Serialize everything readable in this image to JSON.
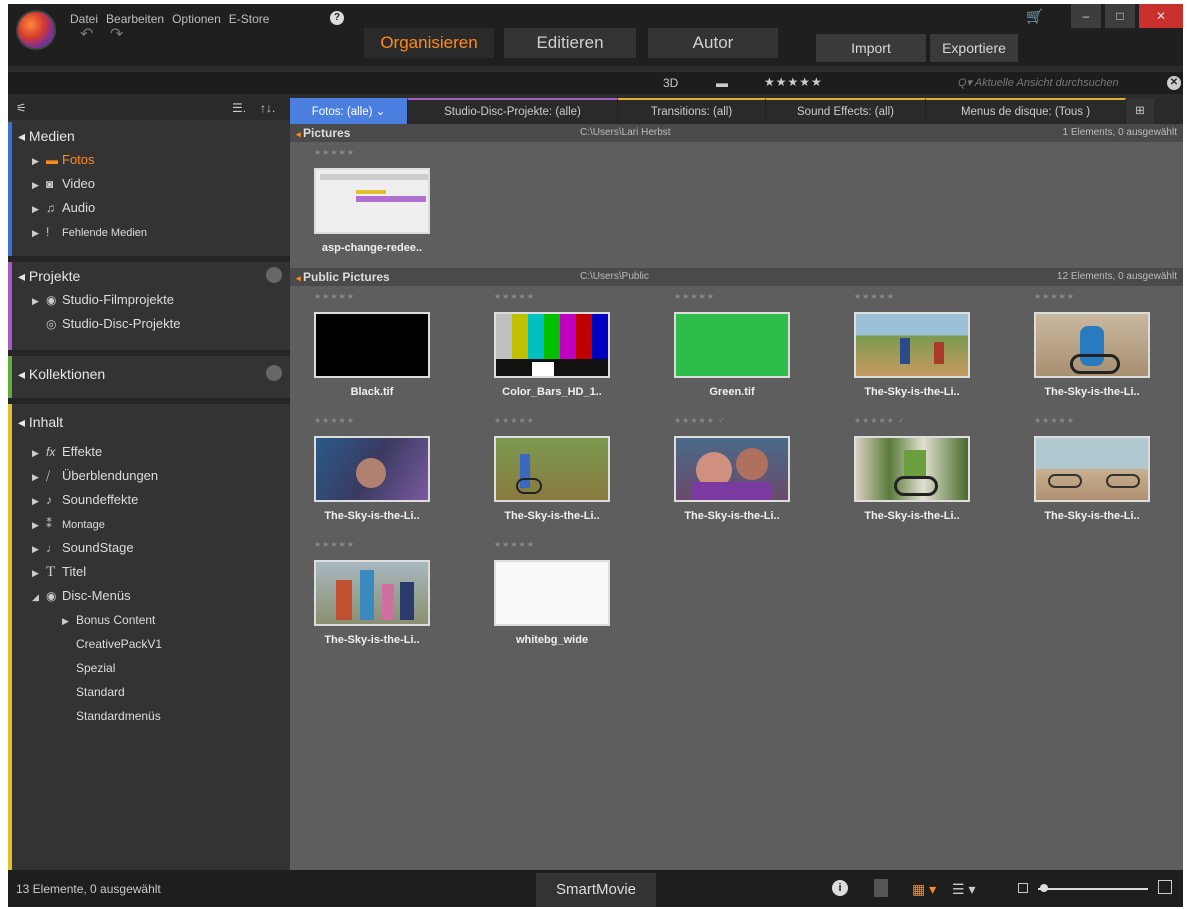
{
  "menu": [
    "Datei",
    "Bearbeiten",
    "Optionen",
    "E-Store"
  ],
  "help_label": "?",
  "undo_redo": "↶ ↷",
  "mode_tabs": {
    "organize": "Organisieren",
    "edit": "Editieren",
    "author": "Autor"
  },
  "buttons": {
    "import": "Import",
    "export": "Exportiere"
  },
  "window_controls": {
    "minimize": "–",
    "maximize": "□",
    "close": "✕"
  },
  "cart_icon": "🛒",
  "view_bar": {
    "mode3d": "3D",
    "film": "▬",
    "stars": "★★★★★"
  },
  "search": {
    "placeholder": "Q▾ Aktuelle Ansicht durchsuchen",
    "clear": "✕"
  },
  "sidebar": {
    "top_icon": "⚟",
    "list_icon": "☰.",
    "sort_icon": "↑↓.",
    "medien": {
      "title": "◂ Medien",
      "items": [
        {
          "label": "Fotos",
          "icon": "folder-icon"
        },
        {
          "label": "Video",
          "icon": "video-icon"
        },
        {
          "label": "Audio",
          "icon": "audio-icon"
        },
        {
          "label": "Fehlende Medien",
          "icon": "missing-icon"
        }
      ]
    },
    "projekte": {
      "title": "◂ Projekte",
      "items": [
        {
          "label": "Studio-Filmprojekte"
        },
        {
          "label": "Studio-Disc-Projekte"
        }
      ]
    },
    "kollektionen": {
      "title": "◂ Kollektionen"
    },
    "inhalt": {
      "title": "◂ Inhalt",
      "items": [
        {
          "label": "Effekte",
          "icon": "fx-icon"
        },
        {
          "label": "Überblendungen",
          "icon": "transition-icon"
        },
        {
          "label": "Soundeffekte",
          "icon": "sound-icon"
        },
        {
          "label": "Montage",
          "icon": "montage-icon"
        },
        {
          "label": "SoundStage",
          "icon": "soundstage-icon"
        },
        {
          "label": "Titel",
          "icon": "title-icon"
        },
        {
          "label": "Disc-Menüs",
          "icon": "disc-icon"
        },
        {
          "label": "Bonus Content"
        },
        {
          "label": "CreativePackV1"
        },
        {
          "label": "Spezial"
        },
        {
          "label": "Standard"
        },
        {
          "label": "Standardmenüs"
        }
      ]
    }
  },
  "tabs": [
    {
      "label": "Fotos: (alle) ⌄"
    },
    {
      "label": "Studio-Disc-Projekte: (alle)"
    },
    {
      "label": "Transitions: (all)"
    },
    {
      "label": "Sound Effects: (all)"
    },
    {
      "label": "Menus de disque: (Tous )"
    }
  ],
  "tabs_more": "⊞",
  "groups": [
    {
      "name": "Pictures",
      "path": "C:\\Users\\Lari Herbst",
      "count": "1 Elements, 0 ausgewählt",
      "items": [
        {
          "label": "asp-change-redee..",
          "stars": "★★★★★",
          "kind": "screenshot"
        }
      ]
    },
    {
      "name": "Public Pictures",
      "path": "C:\\Users\\Public",
      "count": "12 Elements, 0 ausgewählt",
      "items": [
        {
          "label": "Black.tif",
          "stars": "★★★★★",
          "kind": "black"
        },
        {
          "label": "Color_Bars_HD_1..",
          "stars": "★★★★★",
          "kind": "bars"
        },
        {
          "label": "Green.tif",
          "stars": "★★★★★",
          "kind": "green"
        },
        {
          "label": "The-Sky-is-the-Li..",
          "stars": "★★★★★",
          "kind": "photo1"
        },
        {
          "label": "The-Sky-is-the-Li..",
          "stars": "★★★★★",
          "kind": "photo2"
        },
        {
          "label": "The-Sky-is-the-Li..",
          "stars": "★★★★★",
          "kind": "photo3"
        },
        {
          "label": "The-Sky-is-the-Li..",
          "stars": "★★★★★",
          "kind": "photo4"
        },
        {
          "label": "The-Sky-is-the-Li..",
          "stars": "★★★★★ ✓",
          "kind": "photo5"
        },
        {
          "label": "The-Sky-is-the-Li..",
          "stars": "★★★★★ ✓",
          "kind": "photo6"
        },
        {
          "label": "The-Sky-is-the-Li..",
          "stars": "★★★★★",
          "kind": "photo7"
        },
        {
          "label": "The-Sky-is-the-Li..",
          "stars": "★★★★★",
          "kind": "photo8"
        },
        {
          "label": "whitebg_wide",
          "stars": "★★★★★",
          "kind": "white"
        }
      ]
    }
  ],
  "status": {
    "text": "13 Elemente, 0 ausgewählt",
    "smartmovie": "SmartMovie",
    "info": "i",
    "grid": "▦ ▾",
    "list": "☰ ▾"
  },
  "colors": {
    "accent": "#ff8a1e",
    "tab_active": "#4a7fe0",
    "medien": "#3d6fd6",
    "projekte": "#a45cc8",
    "kollektionen": "#5fae3c",
    "inhalt": "#e0c030"
  }
}
